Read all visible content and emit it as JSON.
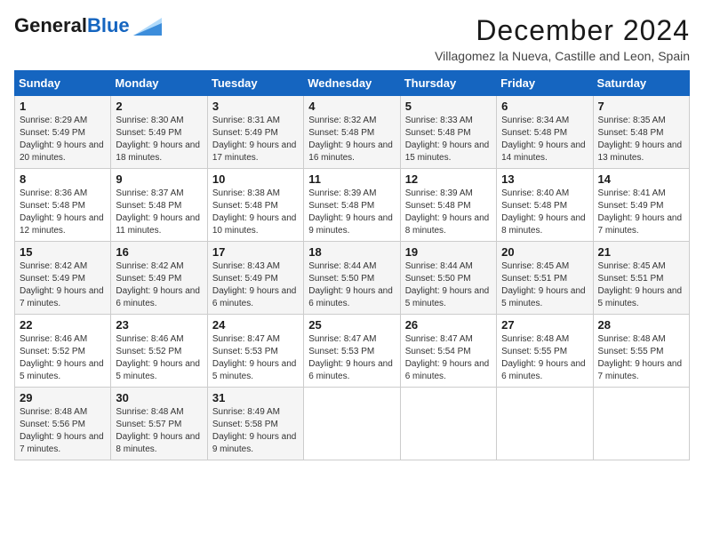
{
  "header": {
    "logo_line1": "General",
    "logo_line2": "Blue",
    "title": "December 2024",
    "subtitle": "Villagomez la Nueva, Castille and Leon, Spain"
  },
  "days_of_week": [
    "Sunday",
    "Monday",
    "Tuesday",
    "Wednesday",
    "Thursday",
    "Friday",
    "Saturday"
  ],
  "weeks": [
    [
      {
        "day": "1",
        "sunrise": "Sunrise: 8:29 AM",
        "sunset": "Sunset: 5:49 PM",
        "daylight": "Daylight: 9 hours and 20 minutes."
      },
      {
        "day": "2",
        "sunrise": "Sunrise: 8:30 AM",
        "sunset": "Sunset: 5:49 PM",
        "daylight": "Daylight: 9 hours and 18 minutes."
      },
      {
        "day": "3",
        "sunrise": "Sunrise: 8:31 AM",
        "sunset": "Sunset: 5:49 PM",
        "daylight": "Daylight: 9 hours and 17 minutes."
      },
      {
        "day": "4",
        "sunrise": "Sunrise: 8:32 AM",
        "sunset": "Sunset: 5:48 PM",
        "daylight": "Daylight: 9 hours and 16 minutes."
      },
      {
        "day": "5",
        "sunrise": "Sunrise: 8:33 AM",
        "sunset": "Sunset: 5:48 PM",
        "daylight": "Daylight: 9 hours and 15 minutes."
      },
      {
        "day": "6",
        "sunrise": "Sunrise: 8:34 AM",
        "sunset": "Sunset: 5:48 PM",
        "daylight": "Daylight: 9 hours and 14 minutes."
      },
      {
        "day": "7",
        "sunrise": "Sunrise: 8:35 AM",
        "sunset": "Sunset: 5:48 PM",
        "daylight": "Daylight: 9 hours and 13 minutes."
      }
    ],
    [
      {
        "day": "8",
        "sunrise": "Sunrise: 8:36 AM",
        "sunset": "Sunset: 5:48 PM",
        "daylight": "Daylight: 9 hours and 12 minutes."
      },
      {
        "day": "9",
        "sunrise": "Sunrise: 8:37 AM",
        "sunset": "Sunset: 5:48 PM",
        "daylight": "Daylight: 9 hours and 11 minutes."
      },
      {
        "day": "10",
        "sunrise": "Sunrise: 8:38 AM",
        "sunset": "Sunset: 5:48 PM",
        "daylight": "Daylight: 9 hours and 10 minutes."
      },
      {
        "day": "11",
        "sunrise": "Sunrise: 8:39 AM",
        "sunset": "Sunset: 5:48 PM",
        "daylight": "Daylight: 9 hours and 9 minutes."
      },
      {
        "day": "12",
        "sunrise": "Sunrise: 8:39 AM",
        "sunset": "Sunset: 5:48 PM",
        "daylight": "Daylight: 9 hours and 8 minutes."
      },
      {
        "day": "13",
        "sunrise": "Sunrise: 8:40 AM",
        "sunset": "Sunset: 5:48 PM",
        "daylight": "Daylight: 9 hours and 8 minutes."
      },
      {
        "day": "14",
        "sunrise": "Sunrise: 8:41 AM",
        "sunset": "Sunset: 5:49 PM",
        "daylight": "Daylight: 9 hours and 7 minutes."
      }
    ],
    [
      {
        "day": "15",
        "sunrise": "Sunrise: 8:42 AM",
        "sunset": "Sunset: 5:49 PM",
        "daylight": "Daylight: 9 hours and 7 minutes."
      },
      {
        "day": "16",
        "sunrise": "Sunrise: 8:42 AM",
        "sunset": "Sunset: 5:49 PM",
        "daylight": "Daylight: 9 hours and 6 minutes."
      },
      {
        "day": "17",
        "sunrise": "Sunrise: 8:43 AM",
        "sunset": "Sunset: 5:49 PM",
        "daylight": "Daylight: 9 hours and 6 minutes."
      },
      {
        "day": "18",
        "sunrise": "Sunrise: 8:44 AM",
        "sunset": "Sunset: 5:50 PM",
        "daylight": "Daylight: 9 hours and 6 minutes."
      },
      {
        "day": "19",
        "sunrise": "Sunrise: 8:44 AM",
        "sunset": "Sunset: 5:50 PM",
        "daylight": "Daylight: 9 hours and 5 minutes."
      },
      {
        "day": "20",
        "sunrise": "Sunrise: 8:45 AM",
        "sunset": "Sunset: 5:51 PM",
        "daylight": "Daylight: 9 hours and 5 minutes."
      },
      {
        "day": "21",
        "sunrise": "Sunrise: 8:45 AM",
        "sunset": "Sunset: 5:51 PM",
        "daylight": "Daylight: 9 hours and 5 minutes."
      }
    ],
    [
      {
        "day": "22",
        "sunrise": "Sunrise: 8:46 AM",
        "sunset": "Sunset: 5:52 PM",
        "daylight": "Daylight: 9 hours and 5 minutes."
      },
      {
        "day": "23",
        "sunrise": "Sunrise: 8:46 AM",
        "sunset": "Sunset: 5:52 PM",
        "daylight": "Daylight: 9 hours and 5 minutes."
      },
      {
        "day": "24",
        "sunrise": "Sunrise: 8:47 AM",
        "sunset": "Sunset: 5:53 PM",
        "daylight": "Daylight: 9 hours and 5 minutes."
      },
      {
        "day": "25",
        "sunrise": "Sunrise: 8:47 AM",
        "sunset": "Sunset: 5:53 PM",
        "daylight": "Daylight: 9 hours and 6 minutes."
      },
      {
        "day": "26",
        "sunrise": "Sunrise: 8:47 AM",
        "sunset": "Sunset: 5:54 PM",
        "daylight": "Daylight: 9 hours and 6 minutes."
      },
      {
        "day": "27",
        "sunrise": "Sunrise: 8:48 AM",
        "sunset": "Sunset: 5:55 PM",
        "daylight": "Daylight: 9 hours and 6 minutes."
      },
      {
        "day": "28",
        "sunrise": "Sunrise: 8:48 AM",
        "sunset": "Sunset: 5:55 PM",
        "daylight": "Daylight: 9 hours and 7 minutes."
      }
    ],
    [
      {
        "day": "29",
        "sunrise": "Sunrise: 8:48 AM",
        "sunset": "Sunset: 5:56 PM",
        "daylight": "Daylight: 9 hours and 7 minutes."
      },
      {
        "day": "30",
        "sunrise": "Sunrise: 8:48 AM",
        "sunset": "Sunset: 5:57 PM",
        "daylight": "Daylight: 9 hours and 8 minutes."
      },
      {
        "day": "31",
        "sunrise": "Sunrise: 8:49 AM",
        "sunset": "Sunset: 5:58 PM",
        "daylight": "Daylight: 9 hours and 9 minutes."
      },
      null,
      null,
      null,
      null
    ]
  ]
}
